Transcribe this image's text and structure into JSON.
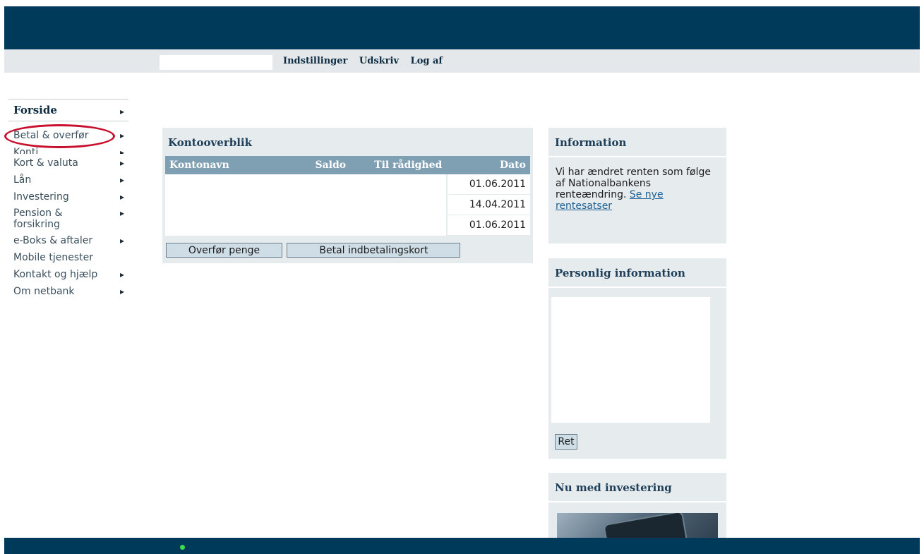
{
  "topnav": {
    "links": [
      "Indstillinger",
      "Udskriv",
      "Log af"
    ]
  },
  "sidebar": {
    "home": "Forside",
    "items": [
      {
        "label": "Betal & overfør",
        "chevron": true
      },
      {
        "label": "Konti",
        "chevron": true
      },
      {
        "label": "Kort & valuta",
        "chevron": true
      },
      {
        "label": "Lån",
        "chevron": true
      },
      {
        "label": "Investering",
        "chevron": true
      },
      {
        "label": "Pension & forsikring",
        "chevron": true
      },
      {
        "label": "e-Boks & aftaler",
        "chevron": true
      },
      {
        "label": "Mobile tjenester",
        "chevron": false
      },
      {
        "label": "Kontakt og hjælp",
        "chevron": true
      },
      {
        "label": "Om netbank",
        "chevron": true
      }
    ],
    "highlight_color": "#c8102e"
  },
  "accounts": {
    "title": "Kontooverblik",
    "columns": [
      "Kontonavn",
      "Saldo",
      "Til rådighed",
      "Dato"
    ],
    "rows": [
      {
        "date": "01.06.2011"
      },
      {
        "date": "14.04.2011"
      },
      {
        "date": "01.06.2011"
      }
    ],
    "buttons": {
      "transfer": "Overfør penge",
      "pay": "Betal indbetalingskort"
    }
  },
  "info": {
    "title": "Information",
    "text": "Vi har ændret renten som følge af Nationalbankens renteændring. ",
    "link": "Se nye rentesatser"
  },
  "personal": {
    "title": "Personlig information",
    "edit_button": "Ret"
  },
  "invest": {
    "title": "Nu med investering"
  },
  "colors": {
    "header": "#003a5a",
    "panel": "#e6ebee",
    "table_header": "#7f9fb3",
    "status_dot": "#3adf48"
  }
}
